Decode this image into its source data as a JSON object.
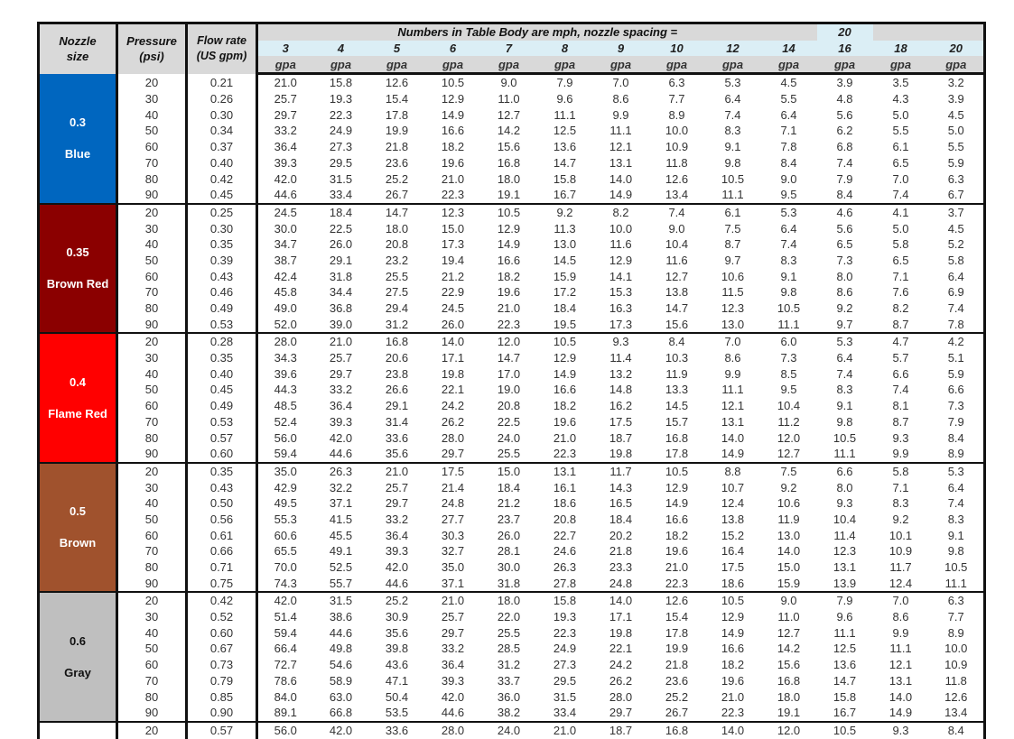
{
  "header": {
    "nozzle_label_line1": "Nozzle",
    "nozzle_label_line2": "size",
    "pressure_label_line1": "Pressure",
    "pressure_label_line2": "(psi)",
    "flow_label_line1": "Flow rate",
    "flow_label_line2": "(US gpm)",
    "title": "Numbers in Table Body are mph, nozzle spacing =",
    "nozzle_spacing": "20",
    "speeds": [
      "3",
      "4",
      "5",
      "6",
      "7",
      "8",
      "9",
      "10",
      "12",
      "14",
      "16",
      "18",
      "20"
    ],
    "unit": "gpa"
  },
  "groups": [
    {
      "size": "0.3",
      "color_name": "Blue",
      "color": "#0066bf",
      "text_color": "#ffffff",
      "rows": [
        {
          "psi": "20",
          "gpm": "0.21",
          "values": [
            "21.0",
            "15.8",
            "12.6",
            "10.5",
            "9.0",
            "7.9",
            "7.0",
            "6.3",
            "5.3",
            "4.5",
            "3.9",
            "3.5",
            "3.2"
          ]
        },
        {
          "psi": "30",
          "gpm": "0.26",
          "values": [
            "25.7",
            "19.3",
            "15.4",
            "12.9",
            "11.0",
            "9.6",
            "8.6",
            "7.7",
            "6.4",
            "5.5",
            "4.8",
            "4.3",
            "3.9"
          ]
        },
        {
          "psi": "40",
          "gpm": "0.30",
          "values": [
            "29.7",
            "22.3",
            "17.8",
            "14.9",
            "12.7",
            "11.1",
            "9.9",
            "8.9",
            "7.4",
            "6.4",
            "5.6",
            "5.0",
            "4.5"
          ]
        },
        {
          "psi": "50",
          "gpm": "0.34",
          "values": [
            "33.2",
            "24.9",
            "19.9",
            "16.6",
            "14.2",
            "12.5",
            "11.1",
            "10.0",
            "8.3",
            "7.1",
            "6.2",
            "5.5",
            "5.0"
          ]
        },
        {
          "psi": "60",
          "gpm": "0.37",
          "values": [
            "36.4",
            "27.3",
            "21.8",
            "18.2",
            "15.6",
            "13.6",
            "12.1",
            "10.9",
            "9.1",
            "7.8",
            "6.8",
            "6.1",
            "5.5"
          ]
        },
        {
          "psi": "70",
          "gpm": "0.40",
          "values": [
            "39.3",
            "29.5",
            "23.6",
            "19.6",
            "16.8",
            "14.7",
            "13.1",
            "11.8",
            "9.8",
            "8.4",
            "7.4",
            "6.5",
            "5.9"
          ]
        },
        {
          "psi": "80",
          "gpm": "0.42",
          "values": [
            "42.0",
            "31.5",
            "25.2",
            "21.0",
            "18.0",
            "15.8",
            "14.0",
            "12.6",
            "10.5",
            "9.0",
            "7.9",
            "7.0",
            "6.3"
          ]
        },
        {
          "psi": "90",
          "gpm": "0.45",
          "values": [
            "44.6",
            "33.4",
            "26.7",
            "22.3",
            "19.1",
            "16.7",
            "14.9",
            "13.4",
            "11.1",
            "9.5",
            "8.4",
            "7.4",
            "6.7"
          ]
        }
      ]
    },
    {
      "size": "0.35",
      "color_name": "Brown Red",
      "color": "#8b0000",
      "text_color": "#ffffff",
      "rows": [
        {
          "psi": "20",
          "gpm": "0.25",
          "values": [
            "24.5",
            "18.4",
            "14.7",
            "12.3",
            "10.5",
            "9.2",
            "8.2",
            "7.4",
            "6.1",
            "5.3",
            "4.6",
            "4.1",
            "3.7"
          ]
        },
        {
          "psi": "30",
          "gpm": "0.30",
          "values": [
            "30.0",
            "22.5",
            "18.0",
            "15.0",
            "12.9",
            "11.3",
            "10.0",
            "9.0",
            "7.5",
            "6.4",
            "5.6",
            "5.0",
            "4.5"
          ]
        },
        {
          "psi": "40",
          "gpm": "0.35",
          "values": [
            "34.7",
            "26.0",
            "20.8",
            "17.3",
            "14.9",
            "13.0",
            "11.6",
            "10.4",
            "8.7",
            "7.4",
            "6.5",
            "5.8",
            "5.2"
          ]
        },
        {
          "psi": "50",
          "gpm": "0.39",
          "values": [
            "38.7",
            "29.1",
            "23.2",
            "19.4",
            "16.6",
            "14.5",
            "12.9",
            "11.6",
            "9.7",
            "8.3",
            "7.3",
            "6.5",
            "5.8"
          ]
        },
        {
          "psi": "60",
          "gpm": "0.43",
          "values": [
            "42.4",
            "31.8",
            "25.5",
            "21.2",
            "18.2",
            "15.9",
            "14.1",
            "12.7",
            "10.6",
            "9.1",
            "8.0",
            "7.1",
            "6.4"
          ]
        },
        {
          "psi": "70",
          "gpm": "0.46",
          "values": [
            "45.8",
            "34.4",
            "27.5",
            "22.9",
            "19.6",
            "17.2",
            "15.3",
            "13.8",
            "11.5",
            "9.8",
            "8.6",
            "7.6",
            "6.9"
          ]
        },
        {
          "psi": "80",
          "gpm": "0.49",
          "values": [
            "49.0",
            "36.8",
            "29.4",
            "24.5",
            "21.0",
            "18.4",
            "16.3",
            "14.7",
            "12.3",
            "10.5",
            "9.2",
            "8.2",
            "7.4"
          ]
        },
        {
          "psi": "90",
          "gpm": "0.53",
          "values": [
            "52.0",
            "39.0",
            "31.2",
            "26.0",
            "22.3",
            "19.5",
            "17.3",
            "15.6",
            "13.0",
            "11.1",
            "9.7",
            "8.7",
            "7.8"
          ]
        }
      ]
    },
    {
      "size": "0.4",
      "color_name": "Flame Red",
      "color": "#ff0000",
      "text_color": "#ffffff",
      "rows": [
        {
          "psi": "20",
          "gpm": "0.28",
          "values": [
            "28.0",
            "21.0",
            "16.8",
            "14.0",
            "12.0",
            "10.5",
            "9.3",
            "8.4",
            "7.0",
            "6.0",
            "5.3",
            "4.7",
            "4.2"
          ]
        },
        {
          "psi": "30",
          "gpm": "0.35",
          "values": [
            "34.3",
            "25.7",
            "20.6",
            "17.1",
            "14.7",
            "12.9",
            "11.4",
            "10.3",
            "8.6",
            "7.3",
            "6.4",
            "5.7",
            "5.1"
          ]
        },
        {
          "psi": "40",
          "gpm": "0.40",
          "values": [
            "39.6",
            "29.7",
            "23.8",
            "19.8",
            "17.0",
            "14.9",
            "13.2",
            "11.9",
            "9.9",
            "8.5",
            "7.4",
            "6.6",
            "5.9"
          ]
        },
        {
          "psi": "50",
          "gpm": "0.45",
          "values": [
            "44.3",
            "33.2",
            "26.6",
            "22.1",
            "19.0",
            "16.6",
            "14.8",
            "13.3",
            "11.1",
            "9.5",
            "8.3",
            "7.4",
            "6.6"
          ]
        },
        {
          "psi": "60",
          "gpm": "0.49",
          "values": [
            "48.5",
            "36.4",
            "29.1",
            "24.2",
            "20.8",
            "18.2",
            "16.2",
            "14.5",
            "12.1",
            "10.4",
            "9.1",
            "8.1",
            "7.3"
          ]
        },
        {
          "psi": "70",
          "gpm": "0.53",
          "values": [
            "52.4",
            "39.3",
            "31.4",
            "26.2",
            "22.5",
            "19.6",
            "17.5",
            "15.7",
            "13.1",
            "11.2",
            "9.8",
            "8.7",
            "7.9"
          ]
        },
        {
          "psi": "80",
          "gpm": "0.57",
          "values": [
            "56.0",
            "42.0",
            "33.6",
            "28.0",
            "24.0",
            "21.0",
            "18.7",
            "16.8",
            "14.0",
            "12.0",
            "10.5",
            "9.3",
            "8.4"
          ]
        },
        {
          "psi": "90",
          "gpm": "0.60",
          "values": [
            "59.4",
            "44.6",
            "35.6",
            "29.7",
            "25.5",
            "22.3",
            "19.8",
            "17.8",
            "14.9",
            "12.7",
            "11.1",
            "9.9",
            "8.9"
          ]
        }
      ]
    },
    {
      "size": "0.5",
      "color_name": "Brown",
      "color": "#a0522d",
      "text_color": "#ffffff",
      "rows": [
        {
          "psi": "20",
          "gpm": "0.35",
          "values": [
            "35.0",
            "26.3",
            "21.0",
            "17.5",
            "15.0",
            "13.1",
            "11.7",
            "10.5",
            "8.8",
            "7.5",
            "6.6",
            "5.8",
            "5.3"
          ]
        },
        {
          "psi": "30",
          "gpm": "0.43",
          "values": [
            "42.9",
            "32.2",
            "25.7",
            "21.4",
            "18.4",
            "16.1",
            "14.3",
            "12.9",
            "10.7",
            "9.2",
            "8.0",
            "7.1",
            "6.4"
          ]
        },
        {
          "psi": "40",
          "gpm": "0.50",
          "values": [
            "49.5",
            "37.1",
            "29.7",
            "24.8",
            "21.2",
            "18.6",
            "16.5",
            "14.9",
            "12.4",
            "10.6",
            "9.3",
            "8.3",
            "7.4"
          ]
        },
        {
          "psi": "50",
          "gpm": "0.56",
          "values": [
            "55.3",
            "41.5",
            "33.2",
            "27.7",
            "23.7",
            "20.8",
            "18.4",
            "16.6",
            "13.8",
            "11.9",
            "10.4",
            "9.2",
            "8.3"
          ]
        },
        {
          "psi": "60",
          "gpm": "0.61",
          "values": [
            "60.6",
            "45.5",
            "36.4",
            "30.3",
            "26.0",
            "22.7",
            "20.2",
            "18.2",
            "15.2",
            "13.0",
            "11.4",
            "10.1",
            "9.1"
          ]
        },
        {
          "psi": "70",
          "gpm": "0.66",
          "values": [
            "65.5",
            "49.1",
            "39.3",
            "32.7",
            "28.1",
            "24.6",
            "21.8",
            "19.6",
            "16.4",
            "14.0",
            "12.3",
            "10.9",
            "9.8"
          ]
        },
        {
          "psi": "80",
          "gpm": "0.71",
          "values": [
            "70.0",
            "52.5",
            "42.0",
            "35.0",
            "30.0",
            "26.3",
            "23.3",
            "21.0",
            "17.5",
            "15.0",
            "13.1",
            "11.7",
            "10.5"
          ]
        },
        {
          "psi": "90",
          "gpm": "0.75",
          "values": [
            "74.3",
            "55.7",
            "44.6",
            "37.1",
            "31.8",
            "27.8",
            "24.8",
            "22.3",
            "18.6",
            "15.9",
            "13.9",
            "12.4",
            "11.1"
          ]
        }
      ]
    },
    {
      "size": "0.6",
      "color_name": "Gray",
      "color": "#bfbfbf",
      "text_color": "#111111",
      "rows": [
        {
          "psi": "20",
          "gpm": "0.42",
          "values": [
            "42.0",
            "31.5",
            "25.2",
            "21.0",
            "18.0",
            "15.8",
            "14.0",
            "12.6",
            "10.5",
            "9.0",
            "7.9",
            "7.0",
            "6.3"
          ]
        },
        {
          "psi": "30",
          "gpm": "0.52",
          "values": [
            "51.4",
            "38.6",
            "30.9",
            "25.7",
            "22.0",
            "19.3",
            "17.1",
            "15.4",
            "12.9",
            "11.0",
            "9.6",
            "8.6",
            "7.7"
          ]
        },
        {
          "psi": "40",
          "gpm": "0.60",
          "values": [
            "59.4",
            "44.6",
            "35.6",
            "29.7",
            "25.5",
            "22.3",
            "19.8",
            "17.8",
            "14.9",
            "12.7",
            "11.1",
            "9.9",
            "8.9"
          ]
        },
        {
          "psi": "50",
          "gpm": "0.67",
          "values": [
            "66.4",
            "49.8",
            "39.8",
            "33.2",
            "28.5",
            "24.9",
            "22.1",
            "19.9",
            "16.6",
            "14.2",
            "12.5",
            "11.1",
            "10.0"
          ]
        },
        {
          "psi": "60",
          "gpm": "0.73",
          "values": [
            "72.7",
            "54.6",
            "43.6",
            "36.4",
            "31.2",
            "27.3",
            "24.2",
            "21.8",
            "18.2",
            "15.6",
            "13.6",
            "12.1",
            "10.9"
          ]
        },
        {
          "psi": "70",
          "gpm": "0.79",
          "values": [
            "78.6",
            "58.9",
            "47.1",
            "39.3",
            "33.7",
            "29.5",
            "26.2",
            "23.6",
            "19.6",
            "16.8",
            "14.7",
            "13.1",
            "11.8"
          ]
        },
        {
          "psi": "80",
          "gpm": "0.85",
          "values": [
            "84.0",
            "63.0",
            "50.4",
            "42.0",
            "36.0",
            "31.5",
            "28.0",
            "25.2",
            "21.0",
            "18.0",
            "15.8",
            "14.0",
            "12.6"
          ]
        },
        {
          "psi": "90",
          "gpm": "0.90",
          "values": [
            "89.1",
            "66.8",
            "53.5",
            "44.6",
            "38.2",
            "33.4",
            "29.7",
            "26.7",
            "22.3",
            "19.1",
            "16.7",
            "14.9",
            "13.4"
          ]
        }
      ]
    },
    {
      "size": "",
      "color_name": "",
      "color": "#ffffff",
      "text_color": "#111111",
      "rows": [
        {
          "psi": "20",
          "gpm": "0.57",
          "values": [
            "56.0",
            "42.0",
            "33.6",
            "28.0",
            "24.0",
            "21.0",
            "18.7",
            "16.8",
            "14.0",
            "12.0",
            "10.5",
            "9.3",
            "8.4"
          ]
        }
      ]
    }
  ]
}
